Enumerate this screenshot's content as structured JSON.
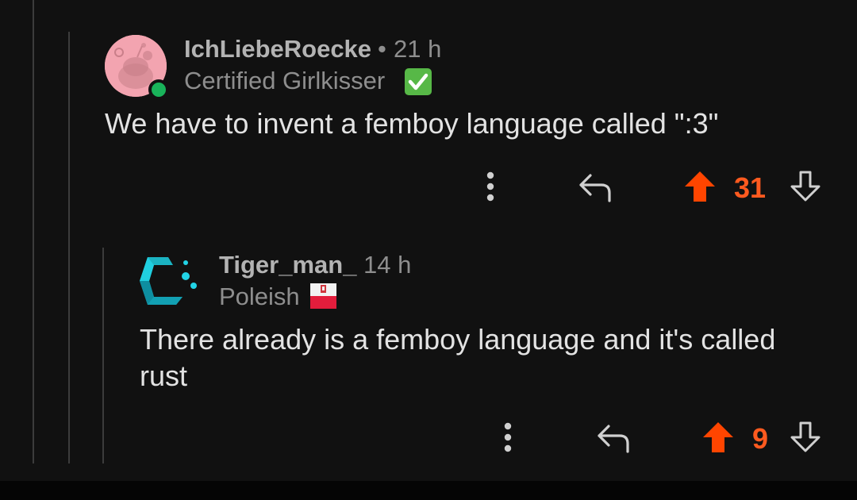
{
  "comments": [
    {
      "username": "IchLiebeRoecke",
      "separator": "•",
      "time": "21 h",
      "flair": "Certified Girlkisser",
      "flair_emoji": "check-mark-button",
      "body": "We have to invent a femboy language called \":3\"",
      "votes": "31",
      "upvoted": true,
      "avatar": "snoo-avatar",
      "online": true
    },
    {
      "username": "Tiger_man_",
      "time": "14 h",
      "flair": "Poleish",
      "flair_emoji": "poland-flag",
      "body_line1": "There already is a femboy language and it's called",
      "body_line2": "rust",
      "votes": "9",
      "upvoted": true,
      "avatar": "cyan-c-logo-avatar"
    }
  ],
  "colors": {
    "background": "#111111",
    "upvote": "#ff4500",
    "vote_count": "#ff5a1f",
    "thread_line": "#3c3c3c",
    "online": "#19b35a"
  },
  "icons": [
    "more-options-icon",
    "reply-icon",
    "upvote-icon",
    "downvote-icon"
  ]
}
